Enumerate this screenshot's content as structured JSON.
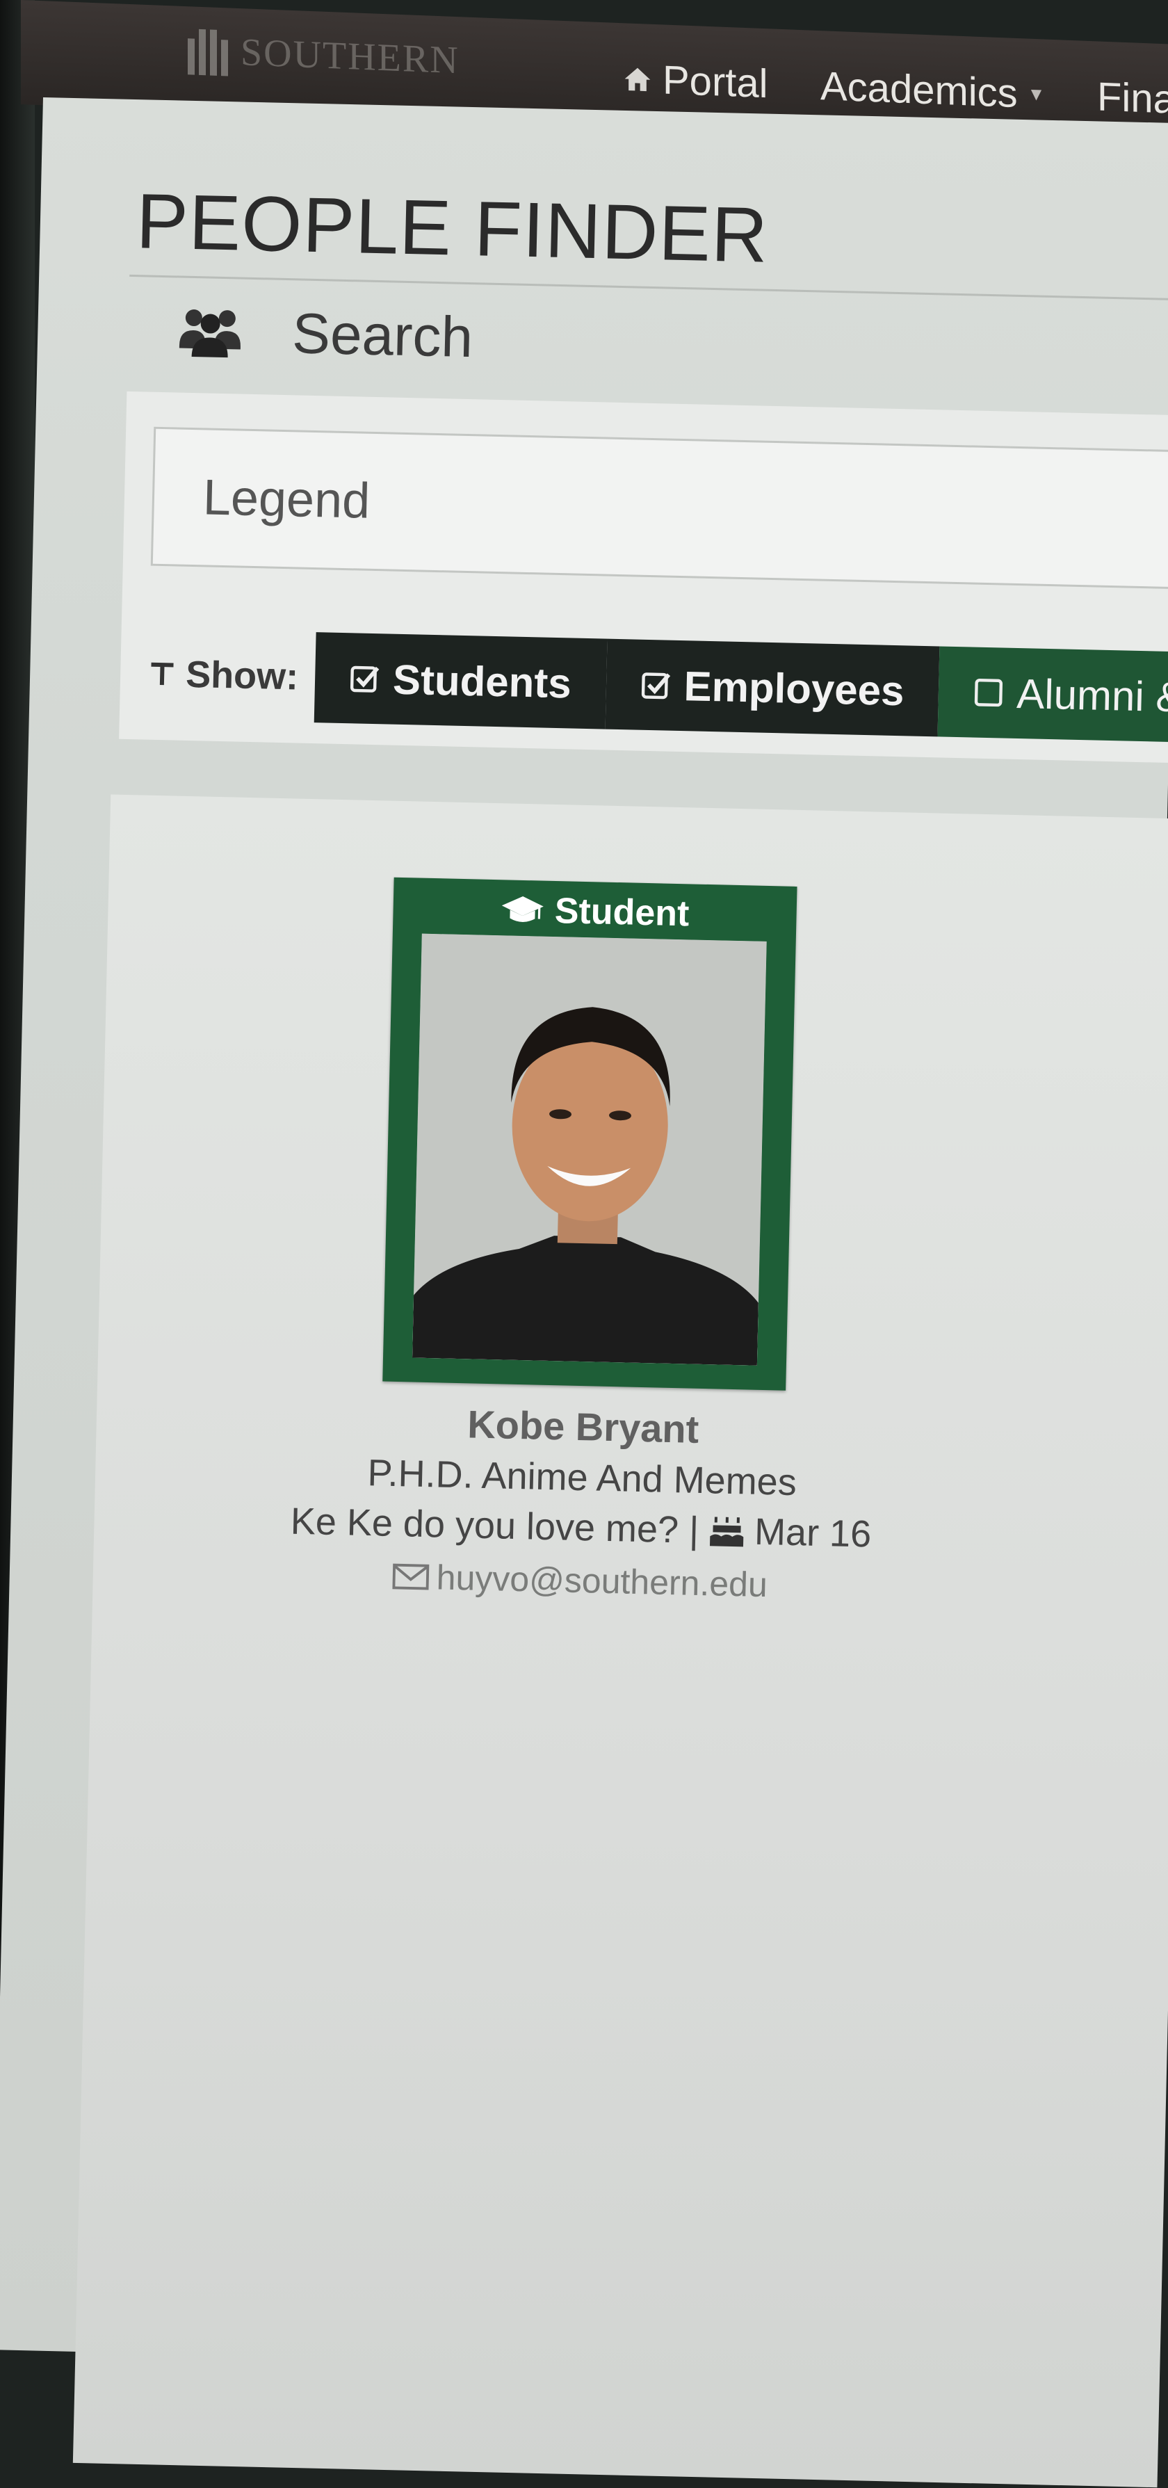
{
  "nav": {
    "logo_text": "SOUTHERN",
    "items": [
      {
        "label": "Portal",
        "icon": "home-icon"
      },
      {
        "label": "Academics",
        "icon": "caret-down"
      },
      {
        "label": "Finan"
      }
    ]
  },
  "page": {
    "title": "PEOPLE FINDER",
    "search_label": "Search"
  },
  "search": {
    "placeholder": "Legend"
  },
  "filters": {
    "show_label": "Show:",
    "options": [
      {
        "label": "Students",
        "checked": true
      },
      {
        "label": "Employees",
        "checked": true
      },
      {
        "label": "Alumni &",
        "checked": false
      }
    ]
  },
  "result": {
    "badge": "Student",
    "name": "Kobe Bryant",
    "title": "P.H.D. Anime And Memes",
    "note": "Ke Ke do you love me? |",
    "birthday": "Mar 16",
    "email": "huyvo@southern.edu"
  },
  "colors": {
    "brand_green": "#1e5e37",
    "filter_dark": "#1d2320",
    "navbar": "#2f2a28"
  }
}
